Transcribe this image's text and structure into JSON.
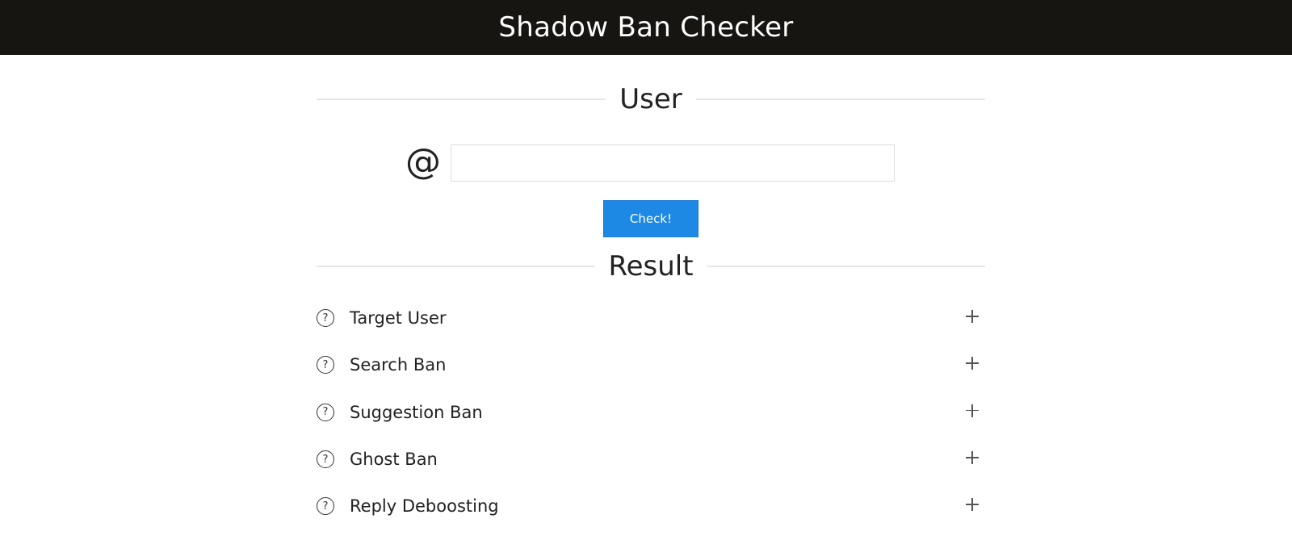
{
  "header": {
    "title": "Shadow Ban Checker"
  },
  "user_section": {
    "heading": "User",
    "at_symbol": "@",
    "username_value": "",
    "check_button_label": "Check!"
  },
  "result_section": {
    "heading": "Result",
    "items": [
      {
        "label": "Target User",
        "status_icon": "question-circle-icon",
        "expand_icon": "plus-icon"
      },
      {
        "label": "Search Ban",
        "status_icon": "question-circle-icon",
        "expand_icon": "plus-icon"
      },
      {
        "label": "Suggestion Ban",
        "status_icon": "question-circle-icon",
        "expand_icon": "plus-icon"
      },
      {
        "label": "Ghost Ban",
        "status_icon": "question-circle-icon",
        "expand_icon": "plus-icon"
      },
      {
        "label": "Reply Deboosting",
        "status_icon": "question-circle-icon",
        "expand_icon": "plus-icon"
      }
    ]
  },
  "colors": {
    "header_bg": "#171511",
    "button_bg": "#1e88e5",
    "divider": "#e6e6e8"
  }
}
